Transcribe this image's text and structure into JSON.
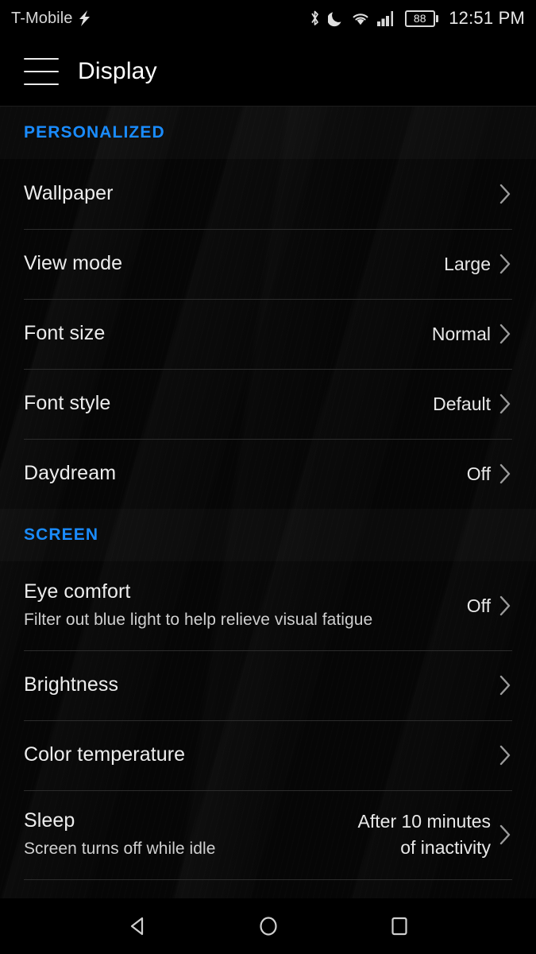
{
  "statusbar": {
    "carrier": "T-Mobile",
    "charging_icon": "lightning-bolt-icon",
    "bluetooth_icon": "bluetooth-icon",
    "dnd_icon": "moon-icon",
    "wifi_icon": "wifi-icon",
    "signal_icon": "cellular-signal-icon",
    "battery_level": "88",
    "time": "12:51 PM"
  },
  "toolbar": {
    "menu_icon": "hamburger-menu-icon",
    "title": "Display"
  },
  "sections": [
    {
      "header": "PERSONALIZED",
      "rows": [
        {
          "title": "Wallpaper",
          "subtitle": "",
          "value": ""
        },
        {
          "title": "View mode",
          "subtitle": "",
          "value": "Large"
        },
        {
          "title": "Font size",
          "subtitle": "",
          "value": "Normal"
        },
        {
          "title": "Font style",
          "subtitle": "",
          "value": "Default"
        },
        {
          "title": "Daydream",
          "subtitle": "",
          "value": "Off"
        }
      ]
    },
    {
      "header": "SCREEN",
      "rows": [
        {
          "title": "Eye comfort",
          "subtitle": "Filter out blue light to help relieve visual fatigue",
          "value": "Off"
        },
        {
          "title": "Brightness",
          "subtitle": "",
          "value": ""
        },
        {
          "title": "Color temperature",
          "subtitle": "",
          "value": ""
        },
        {
          "title": "Sleep",
          "subtitle": "Screen turns off while idle",
          "value": "After 10 minutes\nof inactivity"
        }
      ]
    }
  ],
  "navbar": {
    "back": "back-icon",
    "home": "home-icon",
    "recents": "recents-icon"
  },
  "colors": {
    "accent_blue": "#1a8cff",
    "background": "#000000",
    "divider": "#2c2c2c",
    "primary_text": "#ededed",
    "secondary_text": "#cfcfcf"
  }
}
